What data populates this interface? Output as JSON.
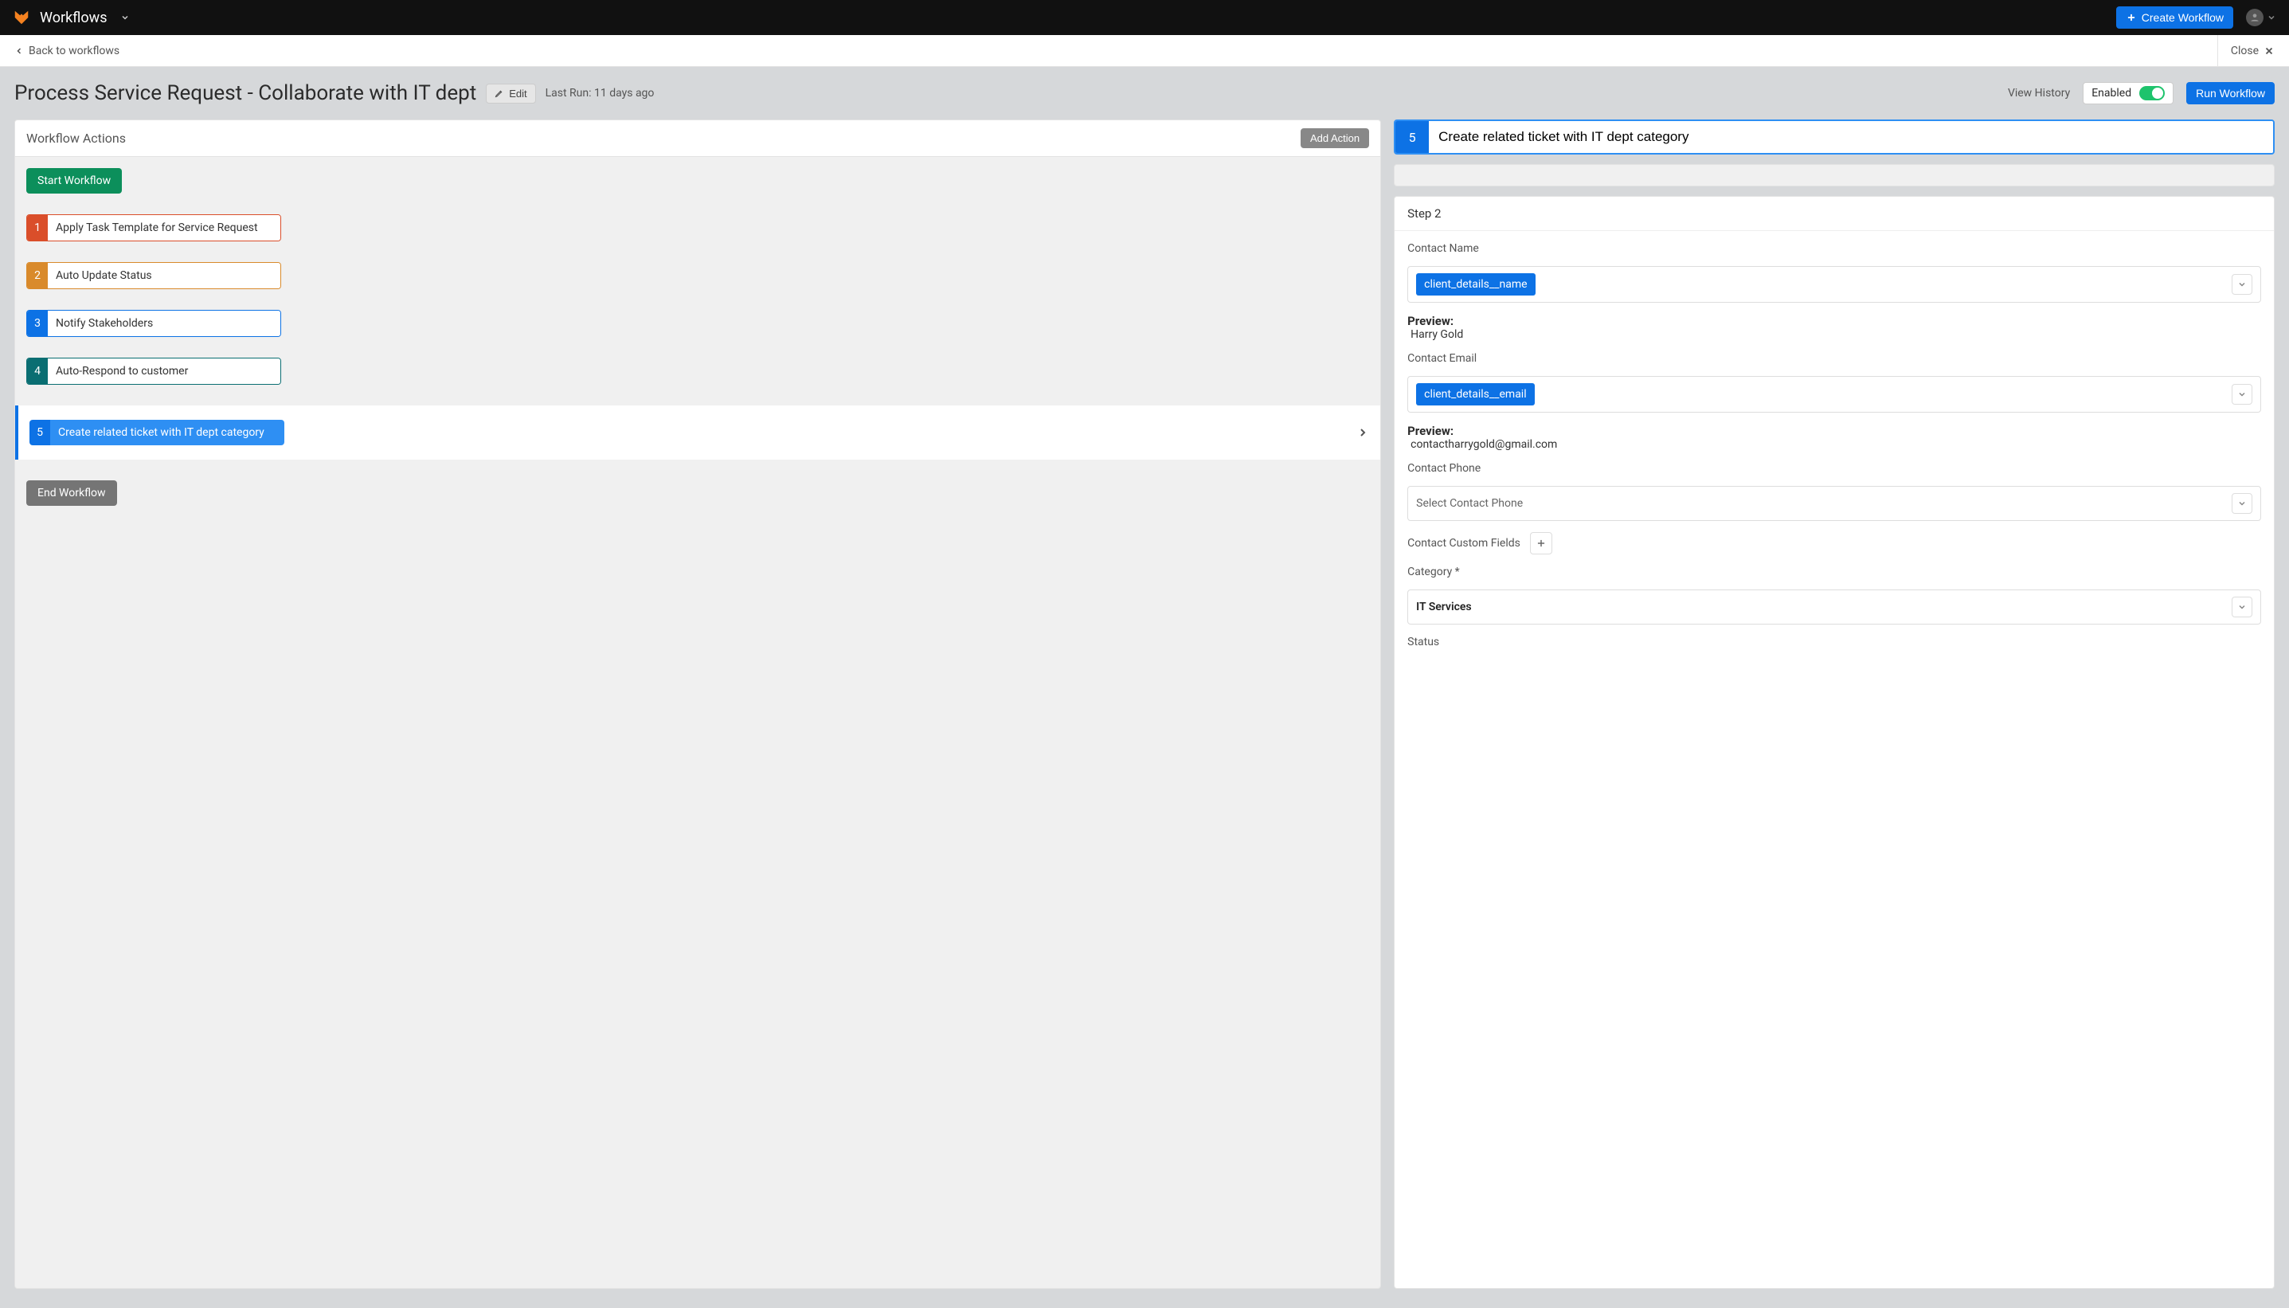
{
  "top": {
    "title": "Workflows",
    "create_button": "Create Workflow"
  },
  "subbar": {
    "back": "Back to workflows",
    "close": "Close"
  },
  "page": {
    "title": "Process Service Request - Collaborate with IT dept",
    "edit": "Edit",
    "last_run": "Last Run: 11 days ago",
    "view_history": "View History",
    "enabled_label": "Enabled",
    "run": "Run Workflow"
  },
  "left": {
    "header": "Workflow Actions",
    "add_action": "Add Action",
    "start": "Start Workflow",
    "end": "End Workflow",
    "actions": [
      {
        "num": "1",
        "label": "Apply Task Template for Service Request",
        "color": "action-1"
      },
      {
        "num": "2",
        "label": "Auto Update Status",
        "color": "action-2"
      },
      {
        "num": "3",
        "label": "Notify Stakeholders",
        "color": "action-3"
      },
      {
        "num": "4",
        "label": "Auto-Respond to customer",
        "color": "action-4"
      }
    ],
    "selected": {
      "num": "5",
      "label": "Create related ticket with IT dept category"
    }
  },
  "right": {
    "selected_num": "5",
    "selected_title": "Create related ticket with IT dept category",
    "step_title": "Step 2",
    "contact_name_label": "Contact Name",
    "contact_name_chip": "client_details__name",
    "preview_label": "Preview:",
    "contact_name_preview": "Harry Gold",
    "contact_email_label": "Contact Email",
    "contact_email_chip": "client_details__email",
    "contact_email_preview": "contactharrygold@gmail.com",
    "contact_phone_label": "Contact Phone",
    "contact_phone_placeholder": "Select Contact Phone",
    "custom_fields_label": "Contact Custom Fields",
    "category_label": "Category",
    "category_value": "IT Services",
    "status_label": "Status"
  }
}
